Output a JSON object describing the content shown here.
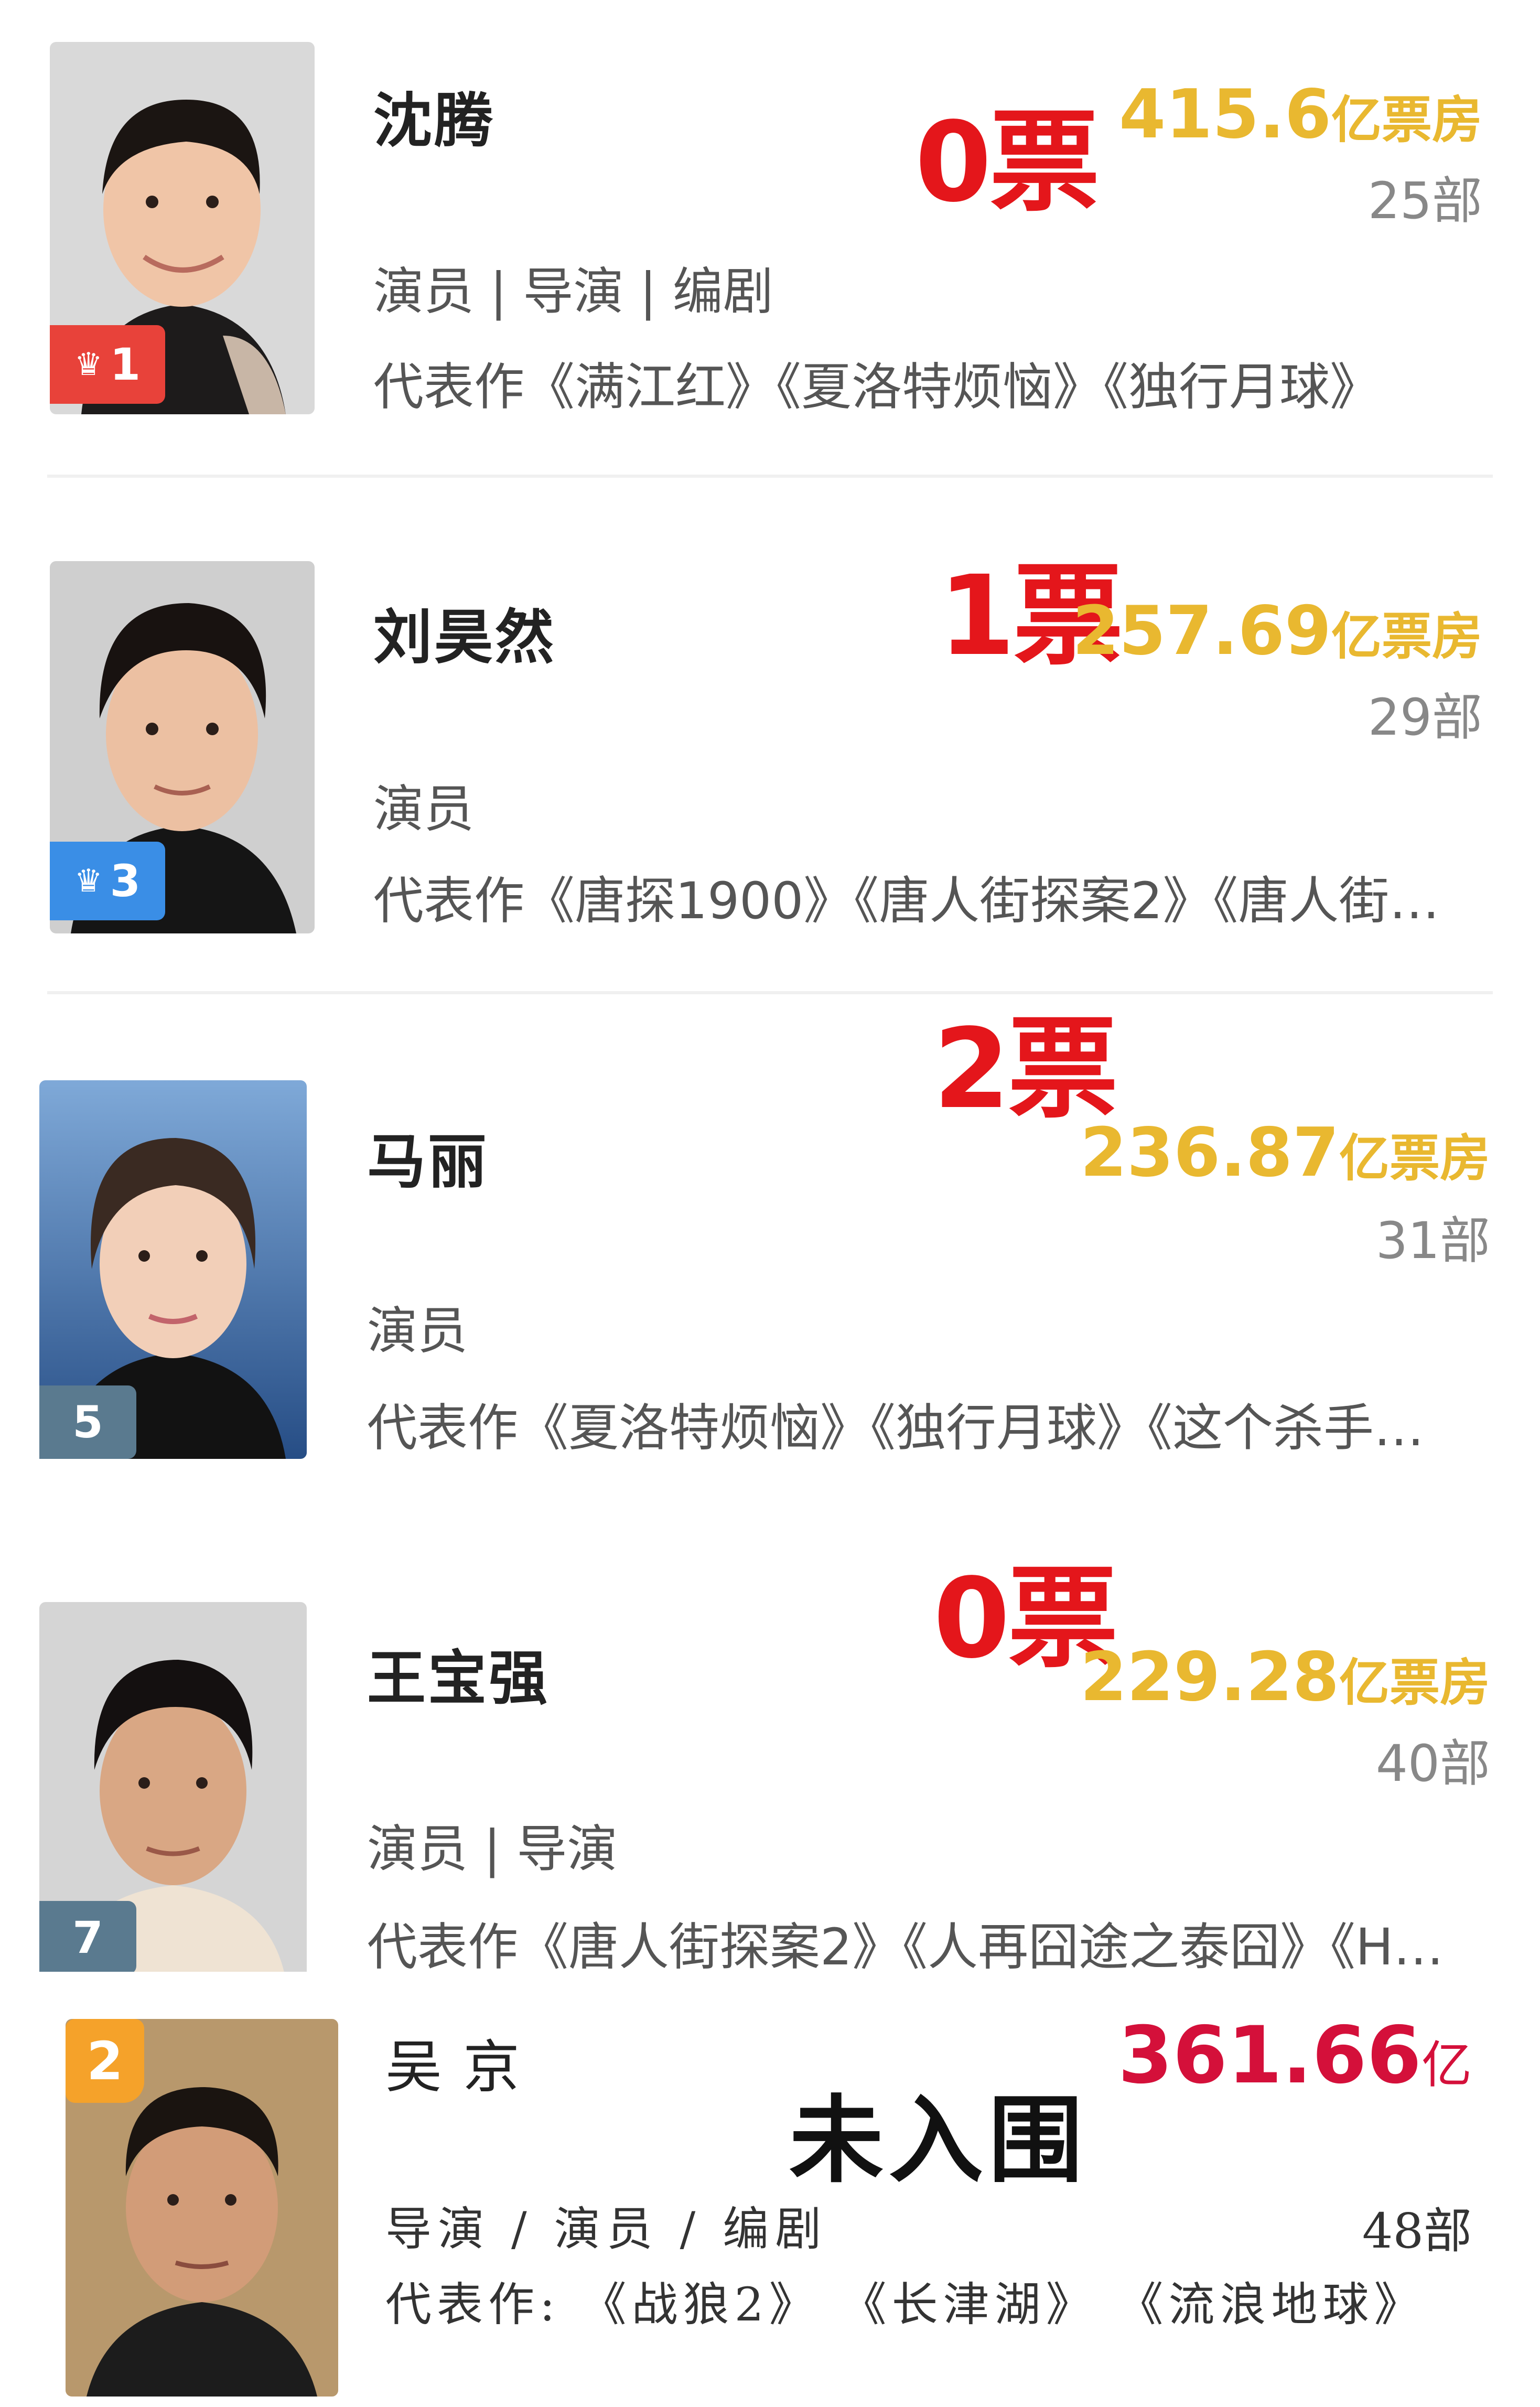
{
  "entries": [
    {
      "name": "沈腾",
      "rank": "1",
      "rank_style": "crown",
      "votes": "0票",
      "box_office_value": "415.6",
      "box_office_unit": "亿票房",
      "film_count": "25部",
      "roles": "演员 | 导演 | 编剧",
      "works": "代表作《满江红》《夏洛特烦恼》《独行月球》"
    },
    {
      "name": "刘昊然",
      "rank": "3",
      "rank_style": "crown",
      "votes": "1票",
      "box_office_value": "257.69",
      "box_office_unit": "亿票房",
      "film_count": "29部",
      "roles": "演员",
      "works": "代表作《唐探1900》《唐人街探案2》《唐人街…"
    },
    {
      "name": "马丽",
      "rank": "5",
      "rank_style": "plain",
      "votes": "2票",
      "box_office_value": "236.87",
      "box_office_unit": "亿票房",
      "film_count": "31部",
      "roles": "演员",
      "works": "代表作《夏洛特烦恼》《独行月球》《这个杀手…"
    },
    {
      "name": "王宝强",
      "rank": "7",
      "rank_style": "plain",
      "votes": "0票",
      "box_office_value": "229.28",
      "box_office_unit": "亿票房",
      "film_count": "40部",
      "roles": "演员 | 导演",
      "works": "代表作《唐人街探案2》《人再囧途之泰囧》《H…"
    }
  ],
  "bottom": {
    "name": "吴京",
    "rank": "2",
    "box_office_value": "361.66",
    "box_office_unit": "亿",
    "film_count": "48部",
    "roles": "导演 / 演员 / 编剧",
    "works": "代表作: 《战狼2》 《长津湖》 《流浪地球》",
    "stamp": "未入围"
  },
  "colors": {
    "votes": "#e4161b",
    "box_office": "#e9b830",
    "bottom_box_office": "#d4103a",
    "badge_red": "#e8423a",
    "badge_blue": "#3a8ee6",
    "badge_gray": "#5a7a8f",
    "rank_orange": "#f5a22a"
  }
}
